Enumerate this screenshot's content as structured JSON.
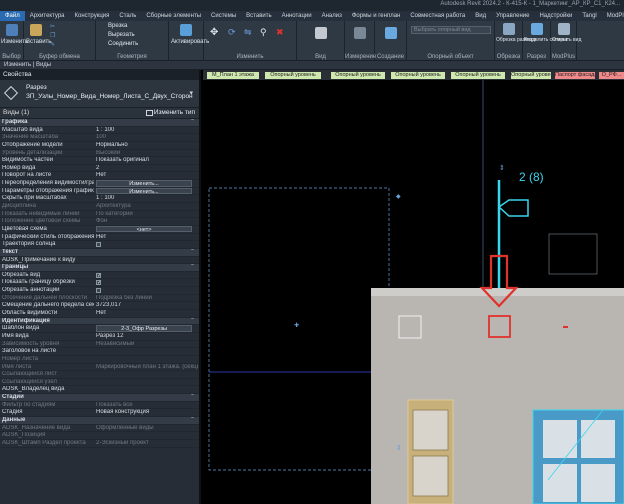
{
  "window": {
    "title": "Autodesk Revit 2024.2 - К-415-К - 1_Маркетинг_АР_КР_С1_К24..."
  },
  "menu": {
    "tabs": [
      "Файл",
      "Архитектура",
      "Конструкция",
      "Сталь",
      "Сборные элементы",
      "Системы",
      "Вставить",
      "Аннотации",
      "Анализ",
      "Формы и генплан",
      "Совместная работа",
      "Вид",
      "Управление",
      "Надстройки",
      "Tangl",
      "ModPlus",
      "Изменить | Виды"
    ]
  },
  "ribbon": {
    "modify_label": "Изменить",
    "select_label": "Выбор",
    "paste_label": "Вставить",
    "clipboard_label": "Буфер обмена",
    "cut_label": "Вырезать",
    "cope_label": "Врезка",
    "join_label": "Соединить",
    "geometry_label": "Геометрия",
    "activate_label": "Активировать",
    "modify_group_label": "Изменить",
    "view_group_label": "Вид",
    "measure_label": "Измерение",
    "create_label": "Создание",
    "workplane_placeholder": "Выбрать опорный вид",
    "ref_object_label": "Опорный объект",
    "crop_label": "Обрезка размера",
    "crop_group_label": "Обрезка",
    "split_label": "Разделить сегмент",
    "section_group_label": "Разрез",
    "open_label": "Открыть вид",
    "modplus_label": "ModPlus"
  },
  "optionsbar": {
    "text": "Изменить | Виды"
  },
  "properties": {
    "header": "Свойства",
    "type_name": "Разрез",
    "type_sub": "ЗП_Узлы_Номер_Вида_Номер_Листа_С_Двух_Сторон",
    "instance_label": "Виды (1)",
    "edit_type": "Изменить тип",
    "rows": [
      {
        "k": "Графика",
        "sec": true
      },
      {
        "k": "Масштаб вида",
        "v": "1 : 100"
      },
      {
        "k": "Значение масштаба",
        "v": "100",
        "dim": true
      },
      {
        "k": "Отображение модели",
        "v": "Нормально"
      },
      {
        "k": "Уровень детализации",
        "v": "Высокий",
        "dim": true
      },
      {
        "k": "Видимость частей",
        "v": "Показать оригинал"
      },
      {
        "k": "Номер вида",
        "v": "2"
      },
      {
        "k": "Поворот на листе",
        "v": "Нет"
      },
      {
        "k": "Переопределения видимости/графики",
        "btn": "Изменить..."
      },
      {
        "k": "Параметры отображения графики",
        "btn": "Изменить..."
      },
      {
        "k": "Скрыть при масштабах",
        "v": "1 : 100"
      },
      {
        "k": "Дисциплина",
        "v": "Архитектура",
        "dim": true
      },
      {
        "k": "Показать невидимые линии",
        "v": "По категории",
        "dim": true
      },
      {
        "k": "Положение цветовой схемы",
        "v": "Фон",
        "dim": true
      },
      {
        "k": "Цветовая схема",
        "btn": "<нет>"
      },
      {
        "k": "Графический стиль отображения рас...",
        "v": "Нет"
      },
      {
        "k": "Траектория солнца",
        "chk": ""
      },
      {
        "k": "Текст",
        "sec": true
      },
      {
        "k": "ADSK_Примечание к виду",
        "v": ""
      },
      {
        "k": "Границы",
        "sec": true
      },
      {
        "k": "Обрезать вид",
        "chk": "✓"
      },
      {
        "k": "Показать границу обрезки",
        "chk": "✓"
      },
      {
        "k": "Обрезать аннотации",
        "chk": ""
      },
      {
        "k": "Отсечение дальней плоскости",
        "v": "Подрезка без линии",
        "dim": true
      },
      {
        "k": "Смещение дальнего предела секуще...",
        "v": "3723,017"
      },
      {
        "k": "Область видимости",
        "v": "Нет"
      },
      {
        "k": "Идентификация",
        "sec": true
      },
      {
        "k": "Шаблон вида",
        "btn": "2-3_Офр Разрезы"
      },
      {
        "k": "Имя вида",
        "v": "Разрез 12"
      },
      {
        "k": "Зависимость уровня",
        "v": "Независимый",
        "dim": true
      },
      {
        "k": "Заголовок на листе",
        "v": ""
      },
      {
        "k": "Номер листа",
        "v": "",
        "dim": true
      },
      {
        "k": "Имя листа",
        "v": "Маркировочный план 1 этажа. (секци...",
        "dim": true
      },
      {
        "k": "Ссылающийся лист",
        "v": "",
        "dim": true
      },
      {
        "k": "Ссылающийся узел",
        "v": "",
        "dim": true
      },
      {
        "k": "ADSK_Владелец вида",
        "v": ""
      },
      {
        "k": "Стадии",
        "sec": true
      },
      {
        "k": "Фильтр по стадиям",
        "v": "Показать все",
        "dim": true
      },
      {
        "k": "Стадия",
        "v": "Новая конструкция"
      },
      {
        "k": "Данные",
        "sec": true
      },
      {
        "k": "ADSK_Назначение вида",
        "v": "Оформленные виды",
        "dim": true
      },
      {
        "k": "ADSK_Позиция",
        "v": "",
        "dim": true
      },
      {
        "k": "ADSK_Штамп Раздел проекта",
        "v": "2-Эскизный проект",
        "dim": true
      }
    ]
  },
  "canvas": {
    "levels": [
      "М_План 1 этажа",
      "Опорный уровень",
      "Опорный уровень",
      "Опорный уровень",
      "Опорный уровень",
      "Опорный уровень",
      "Паспорт фасада",
      "О_РФ..."
    ],
    "callout_label": "2 (8)",
    "colors": {
      "cyan": "#3ad6ee",
      "red": "#e0322c",
      "wall": "#b9b6b2",
      "level_green": "#cfe8b0",
      "level_pink": "#f08a8a"
    }
  }
}
